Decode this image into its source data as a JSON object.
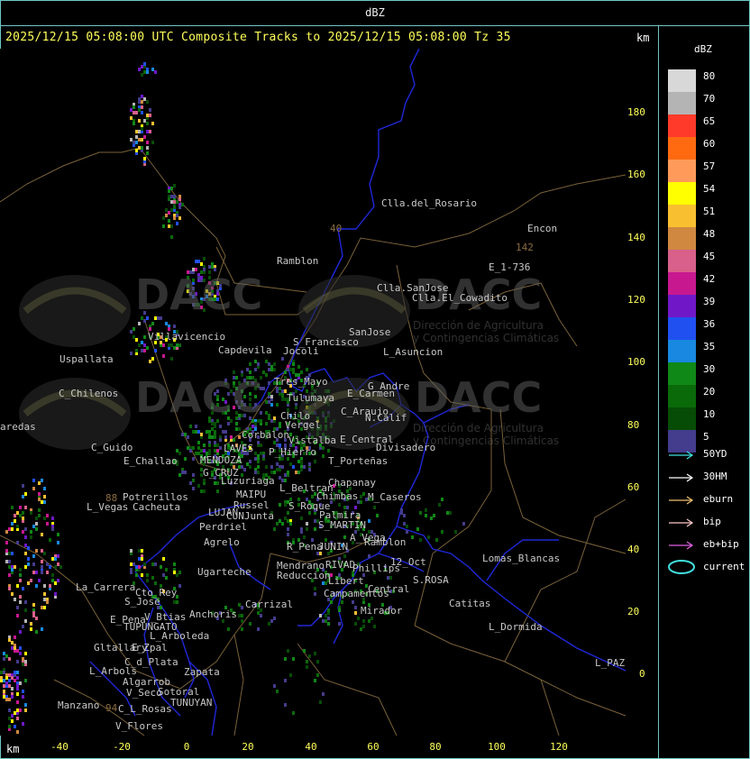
{
  "header": {
    "label": "dBZ"
  },
  "title": "2025/12/15 05:08:00 UTC Composite Tracks to 2025/12/15 05:08:00 Tz 35",
  "unit_top": "km",
  "unit_bottom": "km",
  "y_ticks": [
    "180",
    "160",
    "140",
    "120",
    "100",
    "80",
    "60",
    "40",
    "20",
    "0"
  ],
  "x_ticks": [
    "-40",
    "-20",
    "0",
    "20",
    "40",
    "60",
    "80",
    "100",
    "120"
  ],
  "legend": {
    "title": "dBZ",
    "levels": [
      {
        "label": "80",
        "color": "#d8d8d8"
      },
      {
        "label": "70",
        "color": "#b4b4b4"
      },
      {
        "label": "65",
        "color": "#ff3a2a"
      },
      {
        "label": "60",
        "color": "#ff6a10"
      },
      {
        "label": "57",
        "color": "#ff9a5a"
      },
      {
        "label": "54",
        "color": "#ffff00"
      },
      {
        "label": "51",
        "color": "#f8c030"
      },
      {
        "label": "48",
        "color": "#d08840"
      },
      {
        "label": "45",
        "color": "#d8608a"
      },
      {
        "label": "42",
        "color": "#c81890"
      },
      {
        "label": "39",
        "color": "#7018c8"
      },
      {
        "label": "36",
        "color": "#2050f0"
      },
      {
        "label": "35",
        "color": "#1888e0"
      },
      {
        "label": "30",
        "color": "#108818"
      },
      {
        "label": "20",
        "color": "#0a6a0a"
      },
      {
        "label": "10",
        "color": "#064c06"
      },
      {
        "label": "5",
        "color": "#443c8c"
      }
    ],
    "tracks": [
      {
        "label": "50YD",
        "color": "#40e0e0"
      },
      {
        "label": "30HM",
        "color": "#ffffff"
      },
      {
        "label": "eburn",
        "color": "#f0c070"
      },
      {
        "label": "bip",
        "color": "#ffc8c8"
      },
      {
        "label": "eb+bip",
        "color": "#e060e0"
      },
      {
        "label": "current",
        "color": "#40e0e0"
      }
    ]
  },
  "watermark": {
    "brand": "DACC",
    "line1": "Dirección de Agricultura",
    "line2": "y Contingencias Climáticas"
  },
  "places": [
    {
      "name": "Clla.del_Rosario"
    },
    {
      "name": "Encon"
    },
    {
      "name": "142"
    },
    {
      "name": "E_1-736"
    },
    {
      "name": "Ramblon"
    },
    {
      "name": "40"
    },
    {
      "name": "Clla.SanJose"
    },
    {
      "name": "Clla.El_Cowadito"
    },
    {
      "name": "Villavicencio"
    },
    {
      "name": "S_Francisco"
    },
    {
      "name": "SanJose"
    },
    {
      "name": "Capdevila"
    },
    {
      "name": "Jocoli"
    },
    {
      "name": "L_Asuncion"
    },
    {
      "name": "Uspallata"
    },
    {
      "name": "Tres_Mayo"
    },
    {
      "name": "G_Andre"
    },
    {
      "name": "C_Chilenos"
    },
    {
      "name": "Tulumaya"
    },
    {
      "name": "E_Carmen"
    },
    {
      "name": "C_Araujo"
    },
    {
      "name": "Chilo"
    },
    {
      "name": "N.Calif"
    },
    {
      "name": "Vergel"
    },
    {
      "name": "aredas"
    },
    {
      "name": "Corbalon"
    },
    {
      "name": "Vistalba"
    },
    {
      "name": "E_Central"
    },
    {
      "name": "C_Guido"
    },
    {
      "name": "Divisadero"
    },
    {
      "name": "LAVES"
    },
    {
      "name": "P_Hierro"
    },
    {
      "name": "E_Challao"
    },
    {
      "name": "MENDOZA"
    },
    {
      "name": "T_Porteñas"
    },
    {
      "name": "G_CRUZ"
    },
    {
      "name": "Luzuriaga"
    },
    {
      "name": "Chapanay"
    },
    {
      "name": "L_Beltran"
    },
    {
      "name": "MAIPU"
    },
    {
      "name": "Chimbas"
    },
    {
      "name": "M_Caseros"
    },
    {
      "name": "Potrerillos"
    },
    {
      "name": "88"
    },
    {
      "name": "Russel"
    },
    {
      "name": "L_Vegas"
    },
    {
      "name": "Cacheuta"
    },
    {
      "name": "S_Roque"
    },
    {
      "name": "LUJAN"
    },
    {
      "name": "CUNJunta"
    },
    {
      "name": "Palmira"
    },
    {
      "name": "Perdriel"
    },
    {
      "name": "S_MARTIN"
    },
    {
      "name": "A_Vega"
    },
    {
      "name": "Agrelo"
    },
    {
      "name": "Ramblon"
    },
    {
      "name": "R_Pena"
    },
    {
      "name": "JUNIN"
    },
    {
      "name": "Lomas_Blancas"
    },
    {
      "name": "Mendrano"
    },
    {
      "name": "RIVAD"
    },
    {
      "name": "Phillips"
    },
    {
      "name": "12_Oct"
    },
    {
      "name": "Ugarteche"
    },
    {
      "name": "Reduccion"
    },
    {
      "name": "S.ROSA"
    },
    {
      "name": "Libert"
    },
    {
      "name": "La_Carrera"
    },
    {
      "name": "Cto_Rey"
    },
    {
      "name": "Campamentos"
    },
    {
      "name": "Central"
    },
    {
      "name": "S_Jose"
    },
    {
      "name": "Carrizal"
    },
    {
      "name": "Catitas"
    },
    {
      "name": "Anchoris"
    },
    {
      "name": "Mirador"
    },
    {
      "name": "E_Pena"
    },
    {
      "name": "V_Btias"
    },
    {
      "name": "TUPUNGATO"
    },
    {
      "name": "L_Dormida"
    },
    {
      "name": "L_Arboleda"
    },
    {
      "name": "E_Zpal"
    },
    {
      "name": "Gltallary"
    },
    {
      "name": "L_PAZ"
    },
    {
      "name": "C_d_Plata"
    },
    {
      "name": "L_Arbols"
    },
    {
      "name": "Zapata"
    },
    {
      "name": "Algarrob"
    },
    {
      "name": "V_Seco"
    },
    {
      "name": "Sotoral"
    },
    {
      "name": "Manzano"
    },
    {
      "name": "TUNUYAN"
    },
    {
      "name": "C_L_Rosas"
    },
    {
      "name": "94"
    },
    {
      "name": "V_Flores"
    }
  ]
}
